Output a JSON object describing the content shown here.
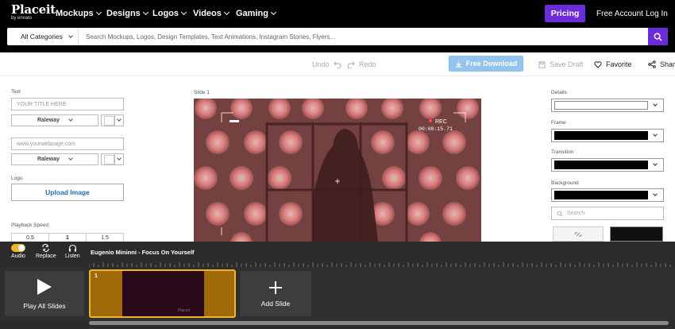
{
  "nav": {
    "logo": "Placeit",
    "logo_sub": "by envato",
    "items": [
      {
        "label": "Mockups"
      },
      {
        "label": "Designs"
      },
      {
        "label": "Logos"
      },
      {
        "label": "Videos"
      },
      {
        "label": "Gaming"
      }
    ],
    "pricing": "Pricing",
    "free_account": "Free Account",
    "login": "Log In"
  },
  "search": {
    "category": "All Categories",
    "placeholder": "Search Mockups, Logos, Design Templates, Text Animations, Instagram Stories, Flyers..."
  },
  "toolbar": {
    "undo": "Undo",
    "redo": "Redo",
    "free_download": "Free Download",
    "save_draft": "Save Draft",
    "favorite": "Favorite",
    "share": "Share"
  },
  "left": {
    "text_label": "Text",
    "title_placeholder": "YOUR TITLE HERE",
    "font1": "Raleway",
    "url_placeholder": "www.yourwebpage.com",
    "font2": "Raleway",
    "logo_label": "Logo",
    "upload": "Upload Image",
    "speed_label": "Playback Speed",
    "speeds": [
      "0.5",
      "1",
      "1.5"
    ]
  },
  "preview": {
    "slide_label": "Slide 1",
    "rec": "REC",
    "timecode": "00:08:15.71"
  },
  "right": {
    "details": "Details",
    "frame": "Frame",
    "transition": "Transition",
    "background": "Background",
    "search_placeholder": "Search"
  },
  "timeline": {
    "audio": "Audio",
    "replace": "Replace",
    "listen": "Listen",
    "track": "Eugenio Mininni - Focus On Yourself",
    "play_all": "Play All Slides",
    "slide_number": "1",
    "slide_watermark": "Placeit",
    "add_slide": "Add Slide"
  },
  "colors": {
    "brand_purple": "#6c2bd9",
    "download_blue": "#92c4ee",
    "slide_gold": "#f0b429"
  }
}
